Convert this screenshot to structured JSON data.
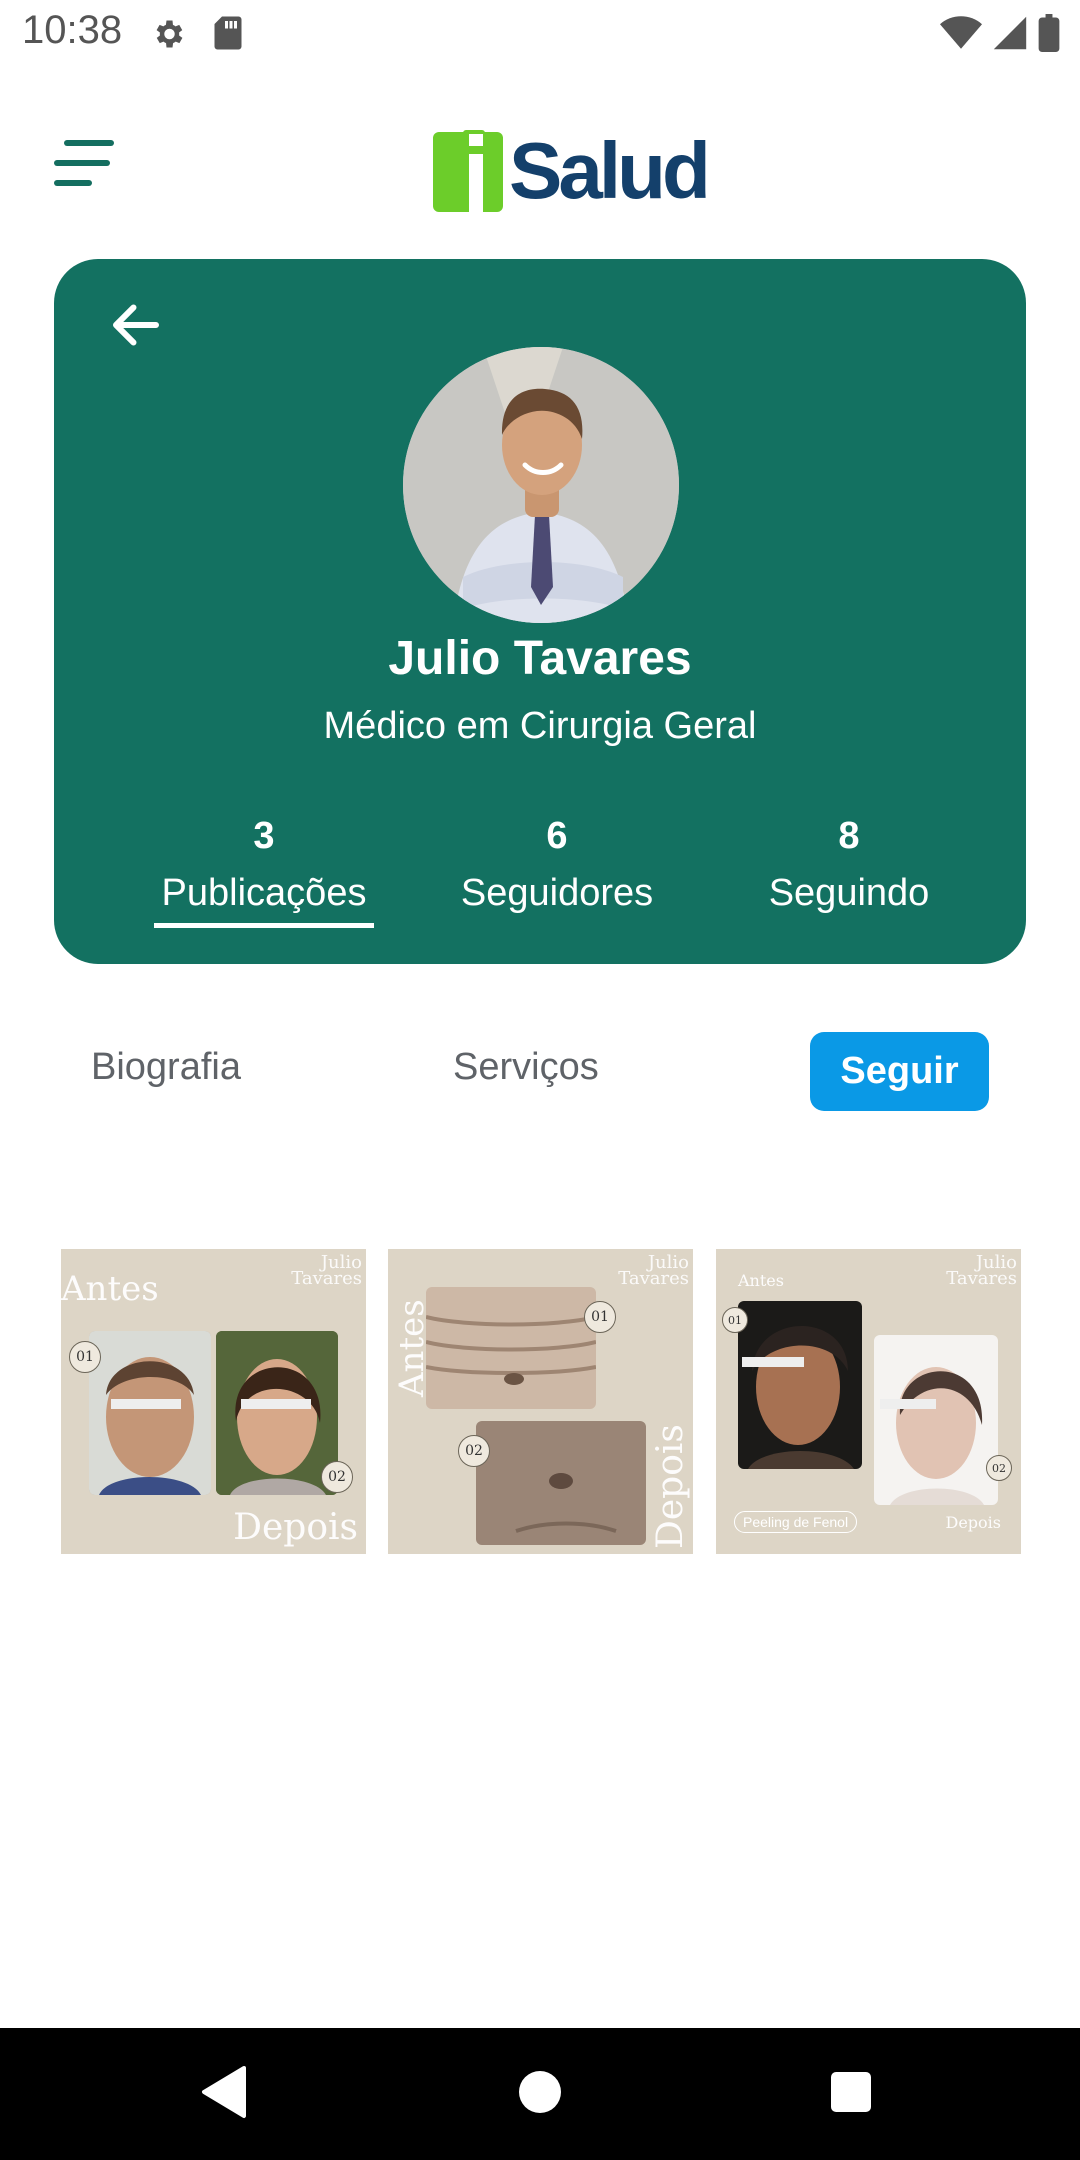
{
  "status_bar": {
    "time": "10:38",
    "icons": [
      "gear-icon",
      "sd-card-icon",
      "wifi-icon",
      "signal-icon",
      "battery-icon"
    ]
  },
  "header": {
    "menu_icon": "menu-icon",
    "logo_text": "Salud",
    "logo_mark_color": "#6ccd2a",
    "logo_text_color": "#14406b"
  },
  "profile": {
    "name": "Julio Tavares",
    "specialty": "Médico em Cirurgia Geral",
    "card_color": "#137161",
    "stats": [
      {
        "value": "3",
        "label": "Publicações",
        "active": true
      },
      {
        "value": "6",
        "label": "Seguidores",
        "active": false
      },
      {
        "value": "8",
        "label": "Seguindo",
        "active": false
      }
    ]
  },
  "tabs": {
    "biography": "Biografia",
    "services": "Serviços",
    "follow_button": "Seguir",
    "follow_color": "#0a99e6"
  },
  "posts": [
    {
      "watermark_line1": "Julio",
      "watermark_line2": "Tavares",
      "before": "Antes",
      "after": "Depois",
      "badge1": "01",
      "badge2": "02"
    },
    {
      "watermark_line1": "Julio",
      "watermark_line2": "Tavares",
      "before": "Antes",
      "after": "Depois",
      "badge1": "01",
      "badge2": "02"
    },
    {
      "watermark_line1": "Julio",
      "watermark_line2": "Tavares",
      "before": "Antes",
      "after": "Depois",
      "badge1": "01",
      "badge2": "02",
      "tag": "Peeling de Fenol"
    }
  ],
  "nav_bar": {
    "icons": [
      "back-triangle-icon",
      "home-circle-icon",
      "recents-square-icon"
    ]
  }
}
